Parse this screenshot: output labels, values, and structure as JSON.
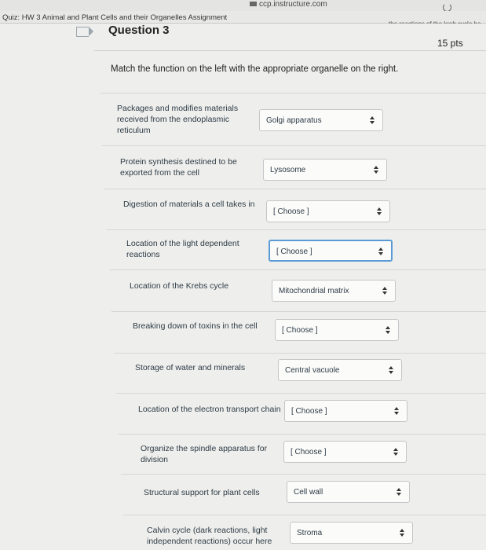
{
  "browser": {
    "url": "ccp.instructure.com",
    "tab_title": "Quiz: HW 3 Animal and Plant Cells and their Organelles Assignment",
    "tab_right_text": "the reactions of the kreb cycle ha"
  },
  "question": {
    "title": "Question 3",
    "points": "15 pts",
    "prompt": "Match the function on the left with the appropriate organelle on the right."
  },
  "rows": [
    {
      "label_lines": [
        "Packages and modifies materials",
        "received from the endoplasmic",
        "reticulum"
      ],
      "selected": "Golgi apparatus"
    },
    {
      "label_lines": [
        "Protein synthesis destined to be",
        "exported from the cell"
      ],
      "selected": "Lysosome"
    },
    {
      "label_lines": [
        "Digestion of materials a cell takes in"
      ],
      "selected": "[ Choose ]"
    },
    {
      "label_lines": [
        "Location of the light dependent",
        "reactions"
      ],
      "selected": "[ Choose ]"
    },
    {
      "label_lines": [
        "Location of the Krebs cycle"
      ],
      "selected": "Mitochondrial matrix"
    },
    {
      "label_lines": [
        "Breaking down of toxins in the cell"
      ],
      "selected": "[ Choose ]"
    },
    {
      "label_lines": [
        "Storage of water and minerals"
      ],
      "selected": "Central vacuole"
    },
    {
      "label_lines": [
        "Location of the electron transport chain"
      ],
      "selected": "[ Choose ]"
    },
    {
      "label_lines": [
        "Organize the spindle apparatus for",
        "division"
      ],
      "selected": "[ Choose ]"
    },
    {
      "label_lines": [
        "Structural support for plant cells"
      ],
      "selected": "Cell wall"
    },
    {
      "label_lines": [
        "Calvin cycle (dark reactions, light",
        "independent reactions) occur here"
      ],
      "selected": "Stroma"
    }
  ]
}
